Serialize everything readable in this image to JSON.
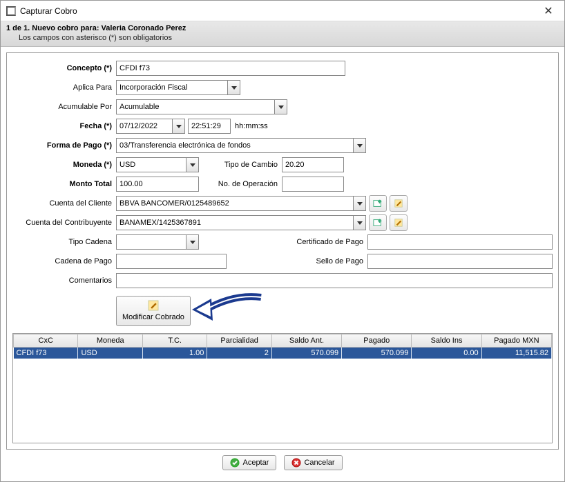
{
  "window": {
    "title": "Capturar Cobro"
  },
  "header": {
    "line1": "1 de 1. Nuevo cobro para: Valeria Coronado Perez",
    "line2": "Los campos con asterisco (*) son obligatorios"
  },
  "labels": {
    "concepto": "Concepto (*)",
    "aplica_para": "Aplica Para",
    "acumulable_por": "Acumulable Por",
    "fecha": "Fecha (*)",
    "hhmmss": "hh:mm:ss",
    "forma_pago": "Forma de Pago (*)",
    "moneda": "Moneda (*)",
    "tipo_cambio": "Tipo de Cambio",
    "monto_total": "Monto Total",
    "no_operacion": "No. de Operación",
    "cuenta_cliente": "Cuenta del Cliente",
    "cuenta_contrib": "Cuenta del Contribuyente",
    "tipo_cadena": "Tipo Cadena",
    "certificado": "Certificado de Pago",
    "cadena_pago": "Cadena de Pago",
    "sello_pago": "Sello de Pago",
    "comentarios": "Comentarios",
    "modificar": "Modificar Cobrado"
  },
  "values": {
    "concepto": "CFDI f73",
    "aplica_para": "Incorporación Fiscal",
    "acumulable_por": "Acumulable",
    "fecha": "07/12/2022",
    "hora": "22:51:29",
    "forma_pago": "03/Transferencia electrónica de fondos",
    "moneda": "USD",
    "tipo_cambio": "20.20",
    "monto_total": "100.00",
    "no_operacion": "",
    "cuenta_cliente": "BBVA BANCOMER/0125489652",
    "cuenta_contrib": "BANAMEX/1425367891",
    "tipo_cadena": "",
    "certificado": "",
    "cadena_pago": "",
    "sello_pago": "",
    "comentarios": ""
  },
  "grid": {
    "headers": [
      "CxC",
      "Moneda",
      "T.C.",
      "Parcialidad",
      "Saldo Ant.",
      "Pagado",
      "Saldo Ins",
      "Pagado MXN"
    ],
    "row": {
      "cxc": "CFDI f73",
      "moneda": "USD",
      "tc": "1.00",
      "parcialidad": "2",
      "saldo_ant": "570.099",
      "pagado": "570.099",
      "saldo_ins": "0.00",
      "pagado_mxn": "11,515.82"
    }
  },
  "buttons": {
    "aceptar": "Aceptar",
    "cancelar": "Cancelar"
  }
}
